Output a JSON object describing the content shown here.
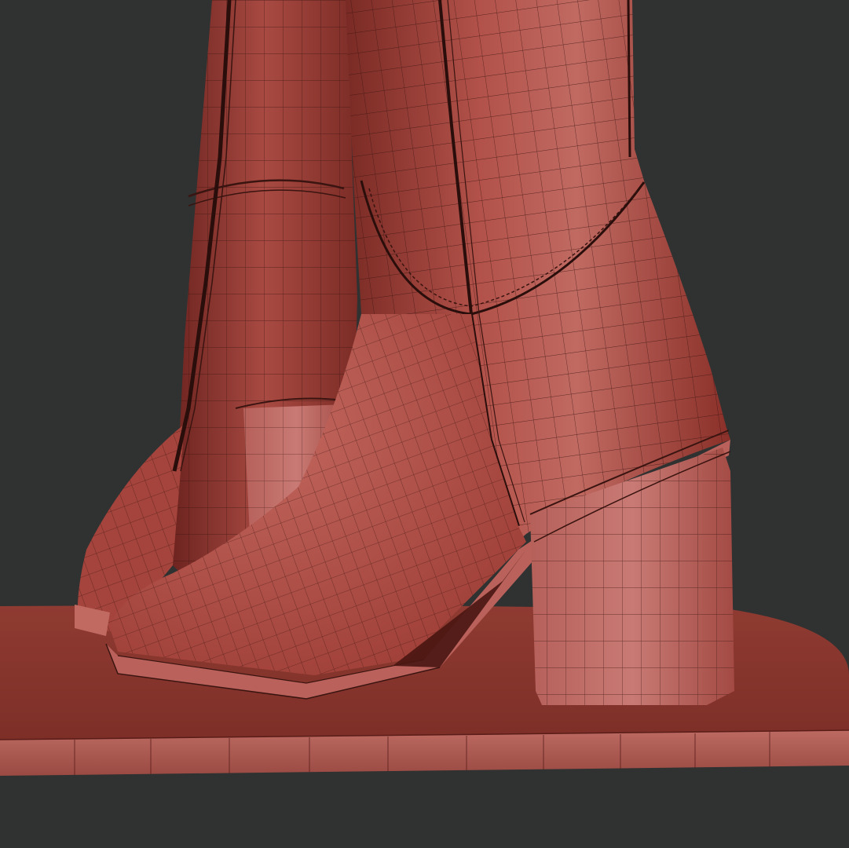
{
  "viewport": {
    "background_color": "#303131"
  },
  "scene": {
    "subject": "render-of-two-heeled-ankle-boots-wireframe",
    "material_color": "#a7443a",
    "material_highlight": "#c9706a",
    "material_shadow": "#5a1c18",
    "wire_color": "#3a1410",
    "base_plate_color": "#8e3a31",
    "base_plate_edge_color": "#b0584e"
  }
}
